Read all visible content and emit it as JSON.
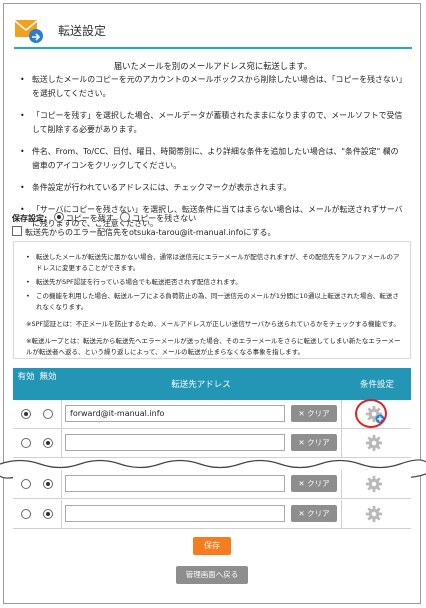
{
  "header": {
    "title": "転送設定",
    "accent": "#22a8c9"
  },
  "intro": "届いたメールを別のメールアドレス宛に転送します。",
  "bullets": [
    "転送したメールのコピーを元のアカウントのメールボックスから削除したい場合は、「コピーを残さない」を選択してください。",
    "「コピーを残す」を選択した場合、メールデータが蓄積されたままになりますので、メールソフトで受信して削除する必要があります。",
    "件名、From、To/CC、日付、曜日、時間帯別に、より詳細な条件を追加したい場合は、\"条件設定\" 欄の歯車のアイコンをクリックしてください。",
    "条件設定が行われているアドレスには、チェックマークが表示されます。",
    "「サーバにコピーを残さない」を選択し、転送条件に当てはまらない場合は、メールが転送されずサーバに残りますので、ご注意ください。"
  ],
  "save_setting": {
    "label": "保存設定:",
    "options": [
      "コピーを残す",
      "コピーを残さない"
    ],
    "selected": "コピーを残す"
  },
  "error_forward": {
    "label": "転送先からのエラー配信先をotsuka-tarou@it-manual.infoにする。",
    "checked": false
  },
  "notes": [
    "転送したメールが転送先に届かない場合、通常は送信元にエラーメールが配信されますが、その配信先をアルファメールのアドレスに変更することができます。",
    "転送先がSPF認証を行っている場合でも転送拒否されず配信されます。",
    "この機能を利用した場合、転送ループによる負荷防止の為、同一送信元のメールが1分間に10通以上転送された場合、転送されなくなります。"
  ],
  "note_spf": "※SPF認証とは：不正メールを防止するため、メールアドレスが正しい送信サーバから送られているかをチェックする機能です。",
  "note_loop": "※転送ループとは：転送元から転送先へエラーメールが送った場合、そのエラーメールをさらに転送してしまい新たなエラーメールが転送者へ返る、という繰り返しによって、メールの転送が止まらなくなる事象を指します。",
  "table": {
    "col_valid": "有効",
    "col_invalid": "無効",
    "col_address": "転送先アドレス",
    "col_condition": "条件設定",
    "header_color": "#2396b5",
    "clear_label": "✕ クリア",
    "rows": [
      {
        "state": "valid",
        "address": "forward@it-manual.info",
        "condition_highlighted": true
      },
      {
        "state": "invalid",
        "address": ""
      },
      {
        "state": "invalid",
        "address": ""
      },
      {
        "state": "invalid",
        "address": ""
      }
    ]
  },
  "buttons": {
    "save": "保存",
    "back": "管理画面へ戻る",
    "save_color": "#f57c1f"
  }
}
